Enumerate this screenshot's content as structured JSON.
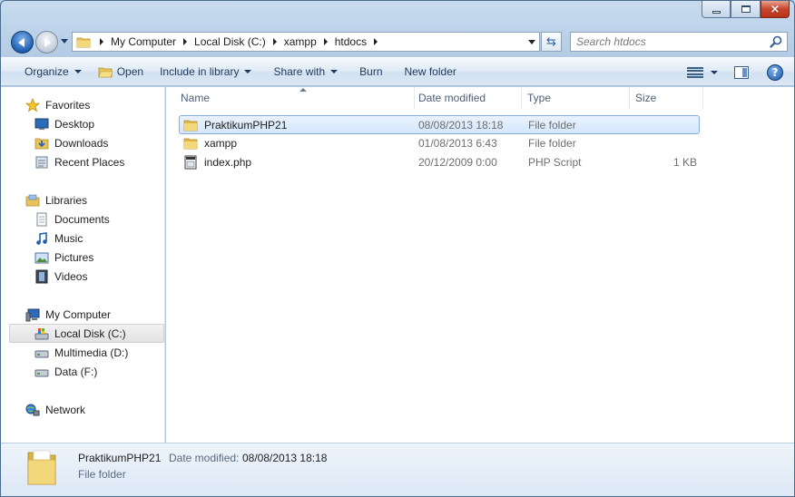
{
  "window": {
    "caption": {
      "minimize": "minimize",
      "maximize": "maximize",
      "close": "×"
    }
  },
  "address": {
    "crumbs": [
      "My Computer",
      "Local Disk (C:)",
      "xampp",
      "htdocs"
    ]
  },
  "search": {
    "placeholder": "Search htdocs"
  },
  "toolbar": {
    "organize": "Organize",
    "open": "Open",
    "include_in_library": "Include in library",
    "share_with": "Share with",
    "burn": "Burn",
    "new_folder": "New folder",
    "help": "?"
  },
  "navpane": {
    "favorites": {
      "label": "Favorites",
      "items": [
        "Desktop",
        "Downloads",
        "Recent Places"
      ]
    },
    "libraries": {
      "label": "Libraries",
      "items": [
        "Documents",
        "Music",
        "Pictures",
        "Videos"
      ]
    },
    "computer": {
      "label": "My Computer",
      "items": [
        "Local Disk (C:)",
        "Multimedia (D:)",
        "Data (F:)"
      ],
      "selected": "Local Disk (C:)"
    },
    "network": {
      "label": "Network"
    }
  },
  "columns": {
    "name": "Name",
    "date_modified": "Date modified",
    "type": "Type",
    "size": "Size"
  },
  "files": [
    {
      "name": "PraktikumPHP21",
      "date": "08/08/2013 18:18",
      "type": "File folder",
      "size": "",
      "icon": "folder-icon",
      "selected": true
    },
    {
      "name": "xampp",
      "date": "01/08/2013 6:43",
      "type": "File folder",
      "size": "",
      "icon": "folder-icon",
      "selected": false
    },
    {
      "name": "index.php",
      "date": "20/12/2009 0:00",
      "type": "PHP Script",
      "size": "1 KB",
      "icon": "php-file-icon",
      "selected": false
    }
  ],
  "details": {
    "name": "PraktikumPHP21",
    "date_label": "Date modified:",
    "date_value": "08/08/2013 18:18",
    "type": "File folder"
  },
  "colors": {
    "accent": "#1f5fb3",
    "selection_border": "#84acdd",
    "chrome": "#b9d1ea",
    "close": "#c7452a"
  }
}
